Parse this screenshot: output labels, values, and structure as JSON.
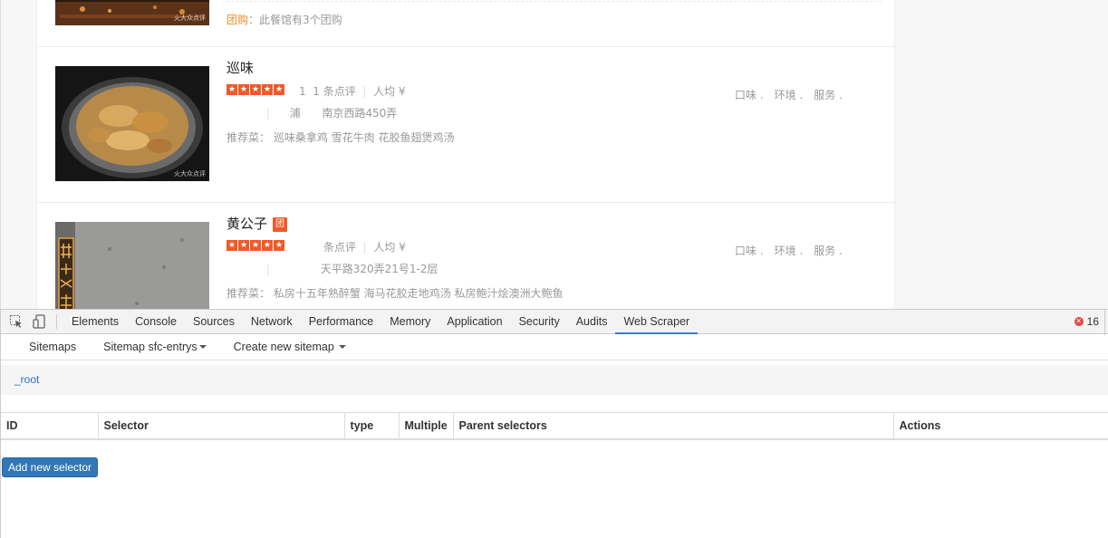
{
  "shops": [
    {
      "group_label": "团购",
      "group_text": "：此餐馆有3个团购",
      "thumb_mark": "⽕大众点评"
    },
    {
      "name": "巡味",
      "has_tuan": false,
      "rating_stars": 5,
      "review_count_prefix": "1",
      "review_count": "1 条点评",
      "avg_label": "人均 ¥",
      "district": "浦",
      "address": "南京西路450弄",
      "rec_label": "推荐菜：",
      "rec_dishes": "巡味桑拿鸡 雪花牛肉 花胶鱼翅煲鸡汤",
      "score_taste": "口味 .",
      "score_env": "环境 .",
      "score_service": "服务 .",
      "thumb_mark": "⽕大众点评"
    },
    {
      "name": "黄公子",
      "has_tuan": true,
      "tuan_label": "团",
      "rating_stars": 5,
      "review_count": "条点评",
      "avg_label": "人均 ¥",
      "district": "",
      "address": "天平路320弄21号1-2层",
      "rec_label": "推荐菜：",
      "rec_dishes": "私房十五年熟醉蟹 海马花胶走地鸡汤 私房鲍汁烩澳洲大鲍鱼",
      "score_taste": "口味 .",
      "score_env": "环境 .",
      "score_service": "服务 ."
    }
  ],
  "devtools": {
    "tabs": [
      "Elements",
      "Console",
      "Sources",
      "Network",
      "Performance",
      "Memory",
      "Application",
      "Security",
      "Audits",
      "Web Scraper"
    ],
    "active_tab": "Web Scraper",
    "error_count": "16",
    "inspect_icon": "inspect-cursor-icon",
    "device_icon": "device-toggle-icon"
  },
  "scraper": {
    "nav": {
      "sitemaps": "Sitemaps",
      "sitemap_current": "Sitemap sfc-entrys",
      "create": "Create new sitemap"
    },
    "breadcrumb": "_root",
    "columns": [
      "ID",
      "Selector",
      "type",
      "Multiple",
      "Parent selectors",
      "Actions"
    ],
    "add_button": "Add new selector"
  },
  "colors": {
    "accent_orange": "#f05a28",
    "link_blue": "#2a6fb8",
    "button_blue": "#3277b8",
    "tab_active": "#3879d9"
  }
}
